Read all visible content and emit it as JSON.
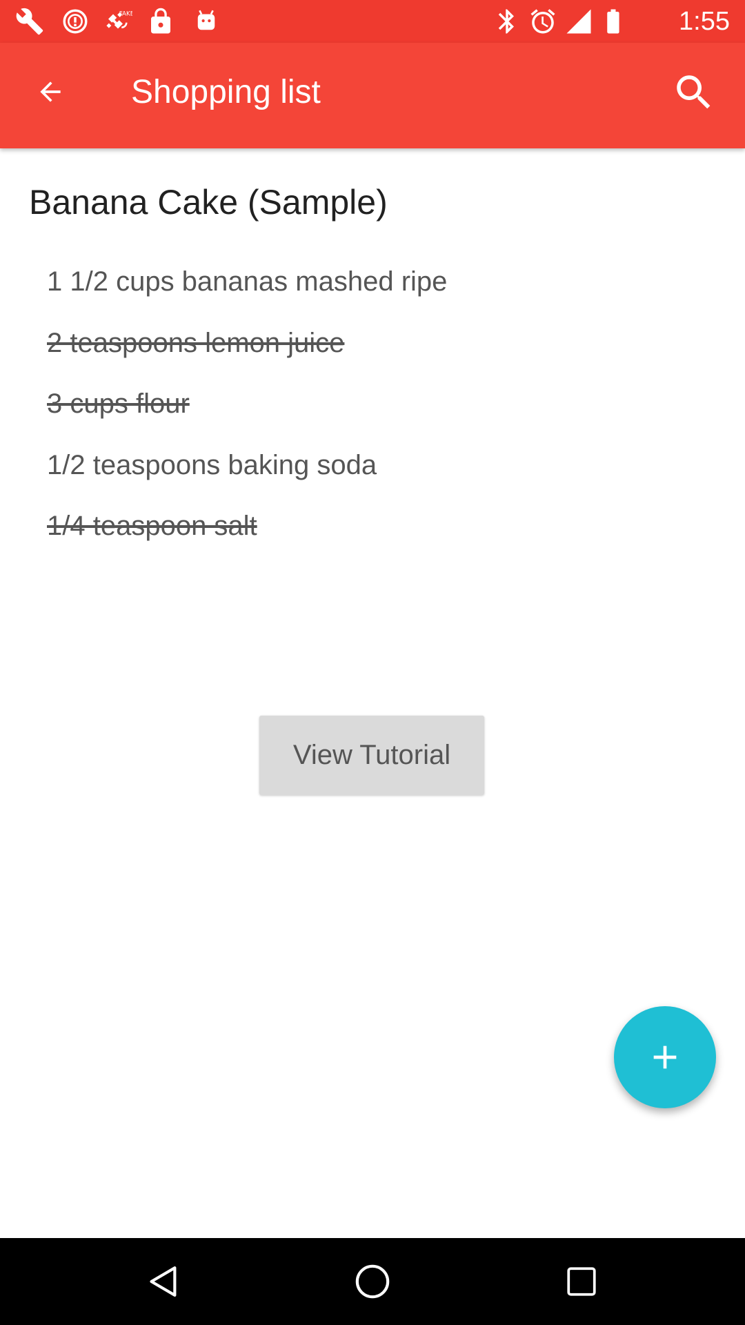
{
  "status_bar": {
    "time": "1:55",
    "icons": [
      "wrench-icon",
      "alert-circle-icon",
      "fake-gps-icon",
      "lock-icon",
      "android-icon",
      "bluetooth-icon",
      "alarm-icon",
      "signal-icon",
      "battery-icon"
    ]
  },
  "app_bar": {
    "title": "Shopping list",
    "back_icon": "arrow-back-icon",
    "search_icon": "search-icon"
  },
  "list": {
    "title": "Banana Cake (Sample)",
    "items": [
      {
        "text": "1 1/2 cups bananas mashed ripe",
        "checked": false
      },
      {
        "text": "2 teaspoons lemon juice",
        "checked": true
      },
      {
        "text": "3 cups flour",
        "checked": true
      },
      {
        "text": "1/2 teaspoons baking soda",
        "checked": false
      },
      {
        "text": "1/4 teaspoon salt",
        "checked": true
      }
    ]
  },
  "tutorial_button": {
    "label": "View Tutorial"
  },
  "fab": {
    "icon": "plus-icon"
  },
  "nav_bar": {
    "icons": [
      "nav-back-icon",
      "nav-home-icon",
      "nav-recents-icon"
    ]
  },
  "colors": {
    "status_bar": "#ef3a2f",
    "app_bar": "#f44538",
    "fab": "#1fbfd4",
    "button": "#dadada",
    "nav_bar": "#000000"
  }
}
